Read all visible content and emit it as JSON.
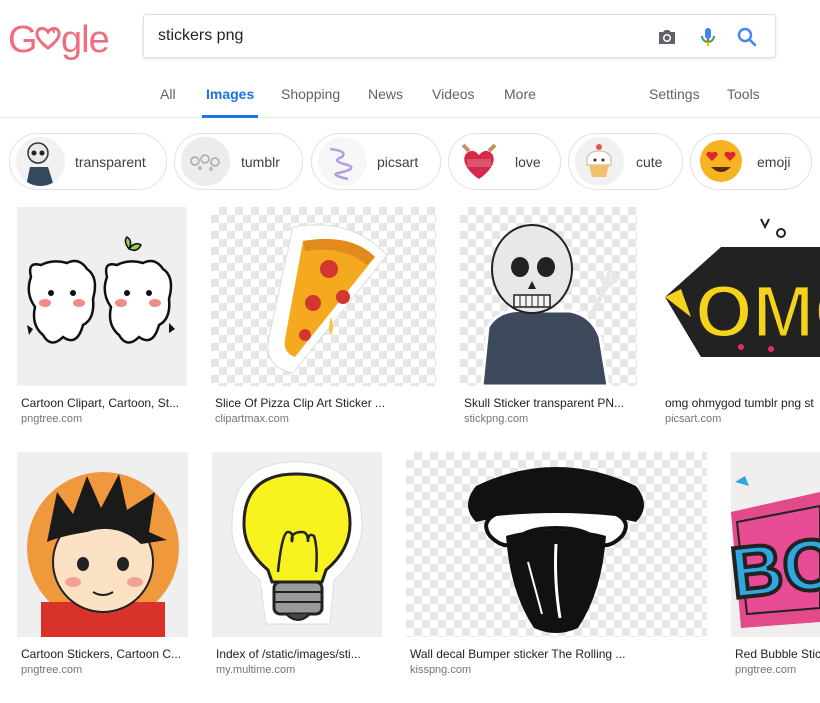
{
  "search": {
    "query": "stickers png"
  },
  "tabs": [
    {
      "label": "All",
      "active": false
    },
    {
      "label": "Images",
      "active": true
    },
    {
      "label": "Shopping",
      "active": false
    },
    {
      "label": "News",
      "active": false
    },
    {
      "label": "Videos",
      "active": false
    },
    {
      "label": "More",
      "active": false
    }
  ],
  "tools": {
    "settings": "Settings",
    "tools": "Tools"
  },
  "chips": [
    {
      "label": "transparent",
      "icon": "skeleton-icon"
    },
    {
      "label": "tumblr",
      "icon": "decor-icon"
    },
    {
      "label": "picsart",
      "icon": "spiral-icon"
    },
    {
      "label": "love",
      "icon": "heart-icon"
    },
    {
      "label": "cute",
      "icon": "cupcake-icon"
    },
    {
      "label": "emoji",
      "icon": "heart-eyes-emoji-icon"
    }
  ],
  "results": [
    {
      "title": "Cartoon Clipart, Cartoon, St...",
      "source": "pngtree.com",
      "icon": "cute-bears-image"
    },
    {
      "title": "Slice Of Pizza Clip Art Sticker ...",
      "source": "clipartmax.com",
      "icon": "pizza-slice-image"
    },
    {
      "title": "Skull Sticker transparent PN...",
      "source": "stickpng.com",
      "icon": "skeleton-image"
    },
    {
      "title": "omg ohmygod tumblr png st",
      "source": "picsart.com",
      "icon": "omg-text-image"
    },
    {
      "title": "Cartoon Stickers, Cartoon C...",
      "source": "pngtree.com",
      "icon": "cartoon-boy-image"
    },
    {
      "title": "Index of /static/images/sti...",
      "source": "my.multime.com",
      "icon": "lightbulb-image"
    },
    {
      "title": "Wall decal Bumper sticker The Rolling ...",
      "source": "kisspng.com",
      "icon": "tongue-lips-image"
    },
    {
      "title": "Red Bubble Stic",
      "source": "pngtree.com",
      "icon": "boom-text-image"
    }
  ],
  "colors": {
    "accent": "#1a73e8",
    "logo": "#ef6e7e"
  }
}
